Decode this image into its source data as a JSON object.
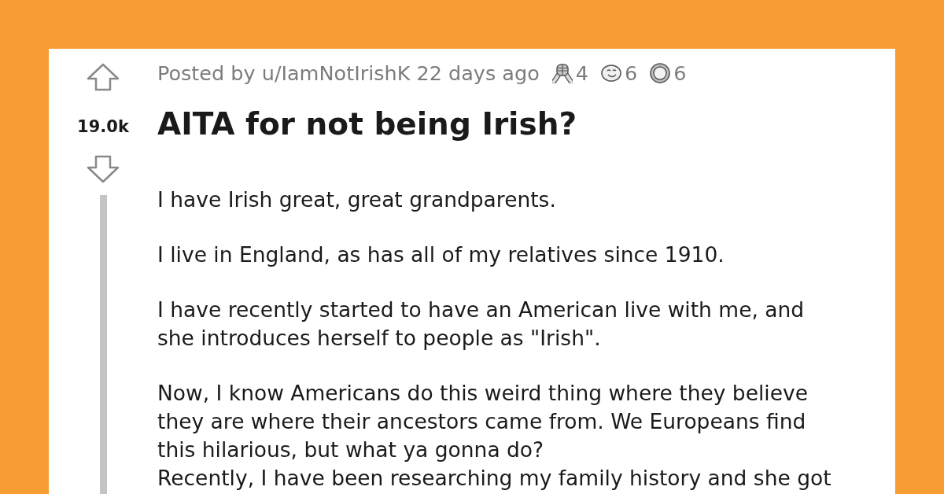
{
  "post": {
    "score": "19.0k",
    "meta": "Posted by u/IamNotIrishK 22 days ago",
    "awards": [
      {
        "kind": "handshake",
        "count": "4"
      },
      {
        "kind": "smile",
        "count": "6"
      },
      {
        "kind": "coin",
        "count": "6"
      }
    ],
    "title": "AITA for not being Irish?",
    "paragraphs": [
      {
        "lines": [
          "I have Irish great, great grandparents."
        ]
      },
      {
        "lines": [
          "I live in England, as has all of my relatives since 1910."
        ]
      },
      {
        "lines": [
          "I have recently started to have an American live with me, and",
          "she introduces herself to people as \"Irish\"."
        ]
      },
      {
        "lines": [
          "Now, I know Americans do this weird thing where they believe",
          "they are where their ancestors came from. We Europeans find",
          "this hilarious, but what ya gonna do?",
          "Recently, I have been researching my family history and she got"
        ]
      }
    ]
  }
}
